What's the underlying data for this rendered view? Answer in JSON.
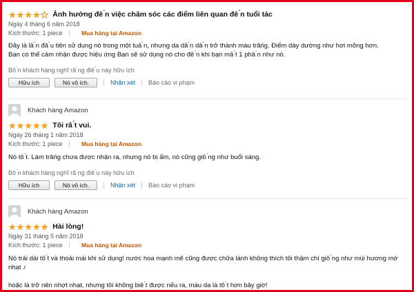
{
  "reviews": [
    {
      "rating": 4,
      "title": "Ảnh hưởng đê ́n việc chăm sóc các điểm liên quan đê ́n tuổi tác",
      "date": "Ngày 4 tháng 6 năm 2018",
      "size_label": "Kích thước: 1 piece",
      "verified": "Mua hàng tại Amazon",
      "body": [
        "Đây là lâ ̀n đâ ̀u tiên sử dụng nó trong một tuâ ̀n, nhưng da dâ ̀n dâ ̀n trở thành màu trăńg. Điểm dày dường như hơi mỏng hơn.",
        "Bạn có thể cảm nhận được hiệu ứng Bạn sẽ sử dụng nó cho đê ́n khi bạn mâ ́t 1 phâ ̀n như nó."
      ],
      "helpful_text": "Bô ́n khách hàng nghĩ ră ̀ng điê ̀u này hữu ích",
      "btn_helpful": "Hữu ích",
      "btn_not_helpful": "Nó vô ích.",
      "comment": "Nhận xét",
      "report": "Báo cáo vi phạm"
    },
    {
      "username": "Khách hàng Amazon",
      "rating": 5,
      "title": "Tôi râ ́t vui.",
      "date": "Ngày 26 tháng 1 năm 2018",
      "size_label": "Kích thước: 1 piece",
      "verified": "Mua hàng tại Amazon",
      "body": [
        "Nó tô ́t. Làm trăńg chưa được nhận ra, nhưng nó bị ẩm, nó cũng giô ́ng như buổi sáng."
      ],
      "helpful_text": "Bô ́n khách hàng nghĩ ră ̀ng điê ̀u này hữu ích",
      "btn_helpful": "Hữu ích",
      "btn_not_helpful": "Nó vô ích.",
      "comment": "Nhận xét",
      "report": "Báo cáo vi phạm"
    },
    {
      "username": "Khách hàng Amazon",
      "rating": 5,
      "title": "Hài lòng!",
      "date": "Ngày 31 tháng 5 năm 2018",
      "size_label": "Kích thước: 1 piece",
      "verified": "Mua hàng tại Amazon",
      "body": [
        "Nó trải dài tô ́t và thoải mái khi sử dụng! nước hoa mạnh mẽ cũng được chữa lành không thích tôi thậm chí giô ́ng như mùi hương mờ",
        "nhạt ♪",
        "",
        "hoặc là trở nên nhợt nhạt, nhưng tôi không biê ́t được nếu ra, màu da là tô ́t hơn bây giờ!"
      ]
    }
  ],
  "colors": {
    "border": "#e3001b",
    "star": "#f5a623",
    "link": "#0066c0",
    "verified": "#c45500"
  },
  "icons": {
    "avatar": "user-silhouette-icon",
    "star_full": "star-filled-icon",
    "star_empty": "star-empty-icon"
  }
}
